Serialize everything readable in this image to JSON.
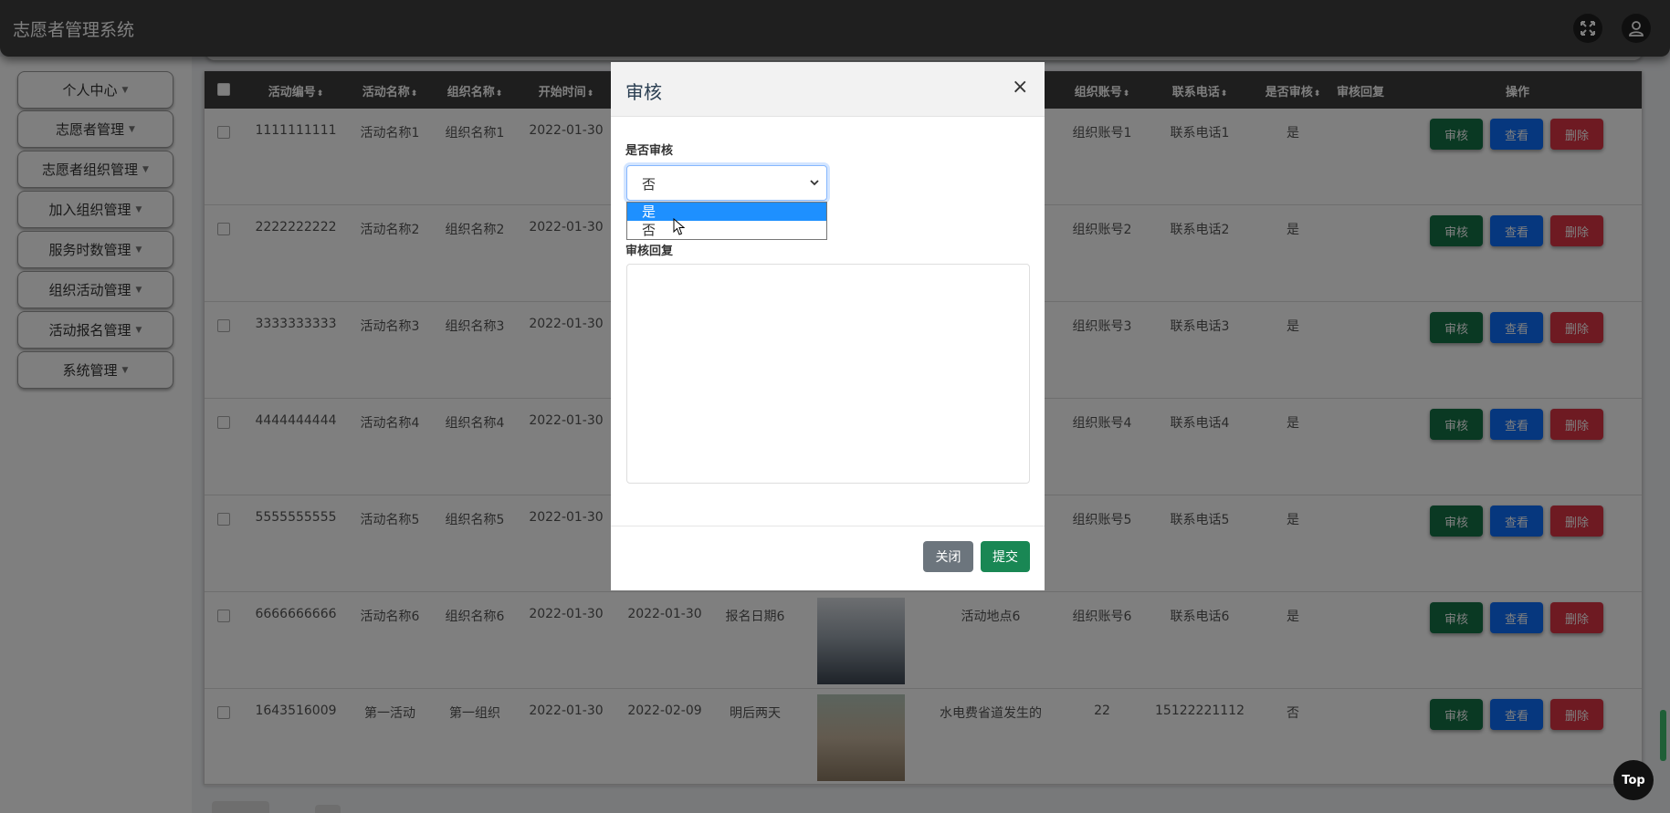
{
  "app": {
    "title": "志愿者管理系统"
  },
  "header": {
    "fullscreen_icon": "fullscreen-icon",
    "user_icon": "user-icon"
  },
  "sidebar": {
    "items": [
      {
        "label": "个人中心"
      },
      {
        "label": "志愿者管理"
      },
      {
        "label": "志愿者组织管理"
      },
      {
        "label": "加入组织管理"
      },
      {
        "label": "服务时数管理"
      },
      {
        "label": "组织活动管理"
      },
      {
        "label": "活动报名管理"
      },
      {
        "label": "系统管理"
      }
    ],
    "caret": "▼"
  },
  "table": {
    "sort_glyph": "⬍",
    "headers": {
      "activity_no": "活动编号",
      "activity_name": "活动名称",
      "org_name": "组织名称",
      "start_time": "开始时间",
      "org_account": "组织账号",
      "phone": "联系电话",
      "audited": "是否审核",
      "audit_reply": "审核回复",
      "actions": "操作"
    },
    "rows": [
      {
        "activity_no": "1111111111",
        "activity_name": "活动名称1",
        "org_name": "组织名称1",
        "start_time": "2022-01-30",
        "end_time": "",
        "signup_date": "",
        "location": "",
        "org_account": "组织账号1",
        "phone": "联系电话1",
        "audited": "是"
      },
      {
        "activity_no": "2222222222",
        "activity_name": "活动名称2",
        "org_name": "组织名称2",
        "start_time": "2022-01-30",
        "end_time": "",
        "signup_date": "",
        "location": "",
        "org_account": "组织账号2",
        "phone": "联系电话2",
        "audited": "是"
      },
      {
        "activity_no": "3333333333",
        "activity_name": "活动名称3",
        "org_name": "组织名称3",
        "start_time": "2022-01-30",
        "end_time": "",
        "signup_date": "",
        "location": "",
        "org_account": "组织账号3",
        "phone": "联系电话3",
        "audited": "是"
      },
      {
        "activity_no": "4444444444",
        "activity_name": "活动名称4",
        "org_name": "组织名称4",
        "start_time": "2022-01-30",
        "end_time": "",
        "signup_date": "",
        "location": "",
        "org_account": "组织账号4",
        "phone": "联系电话4",
        "audited": "是"
      },
      {
        "activity_no": "5555555555",
        "activity_name": "活动名称5",
        "org_name": "组织名称5",
        "start_time": "2022-01-30",
        "end_time": "",
        "signup_date": "",
        "location": "",
        "org_account": "组织账号5",
        "phone": "联系电话5",
        "audited": "是"
      },
      {
        "activity_no": "6666666666",
        "activity_name": "活动名称6",
        "org_name": "组织名称6",
        "start_time": "2022-01-30",
        "end_time": "2022-01-30",
        "signup_date": "报名日期6",
        "location": "活动地点6",
        "org_account": "组织账号6",
        "phone": "联系电话6",
        "audited": "是"
      },
      {
        "activity_no": "1643516009",
        "activity_name": "第一活动",
        "org_name": "第一组织",
        "start_time": "2022-01-30",
        "end_time": "2022-02-09",
        "signup_date": "明后两天",
        "location": "水电费省道发生的",
        "org_account": "22",
        "phone": "15122221112",
        "audited": "否"
      }
    ],
    "buttons": {
      "audit": "审核",
      "view": "查看",
      "delete": "删除"
    }
  },
  "modal": {
    "title": "审核",
    "close_glyph": "×",
    "field_audited_label": "是否审核",
    "select_value": "否",
    "options": [
      "是",
      "否"
    ],
    "highlighted_option": "是",
    "field_reply_label": "审核回复",
    "reply_value": "",
    "close_button": "关闭",
    "submit_button": "提交"
  },
  "top_button": "Top",
  "colors": {
    "header_bg": "#3f3f3f",
    "audit_btn": "#157347",
    "view_btn": "#0d6efd",
    "delete_btn": "#dc3545",
    "option_highlight": "#1e90ff",
    "submit_btn": "#198754",
    "close_btn": "#6c757d"
  }
}
